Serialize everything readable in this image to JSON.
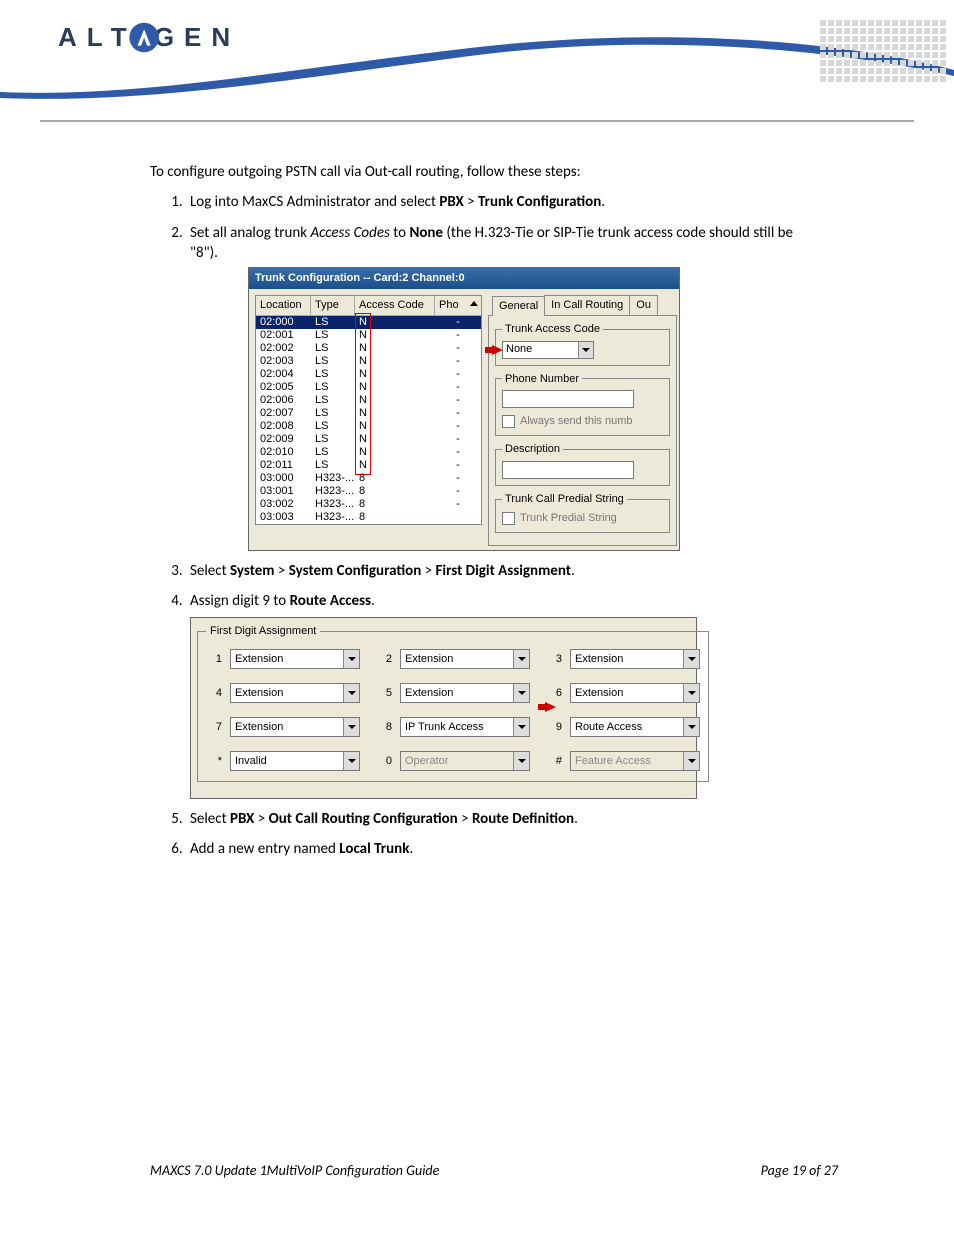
{
  "brand": "ALTIGEN",
  "intro": "To configure outgoing PSTN call via Out-call routing, follow these steps:",
  "steps": {
    "s1": {
      "pre": "Log into MaxCS Administrator and select ",
      "b1": "PBX",
      "mid": " > ",
      "b2": "Trunk Configuration",
      "post": "."
    },
    "s2": {
      "pre": "Set all analog trunk ",
      "i1": "Access Codes",
      "mid": " to ",
      "b1": "None",
      "post": " (the H.323-Tie or SIP-Tie trunk access code should still be \"8\")."
    },
    "s3": {
      "pre": "Select ",
      "b1": "System",
      "m1": " > ",
      "b2": "System Configuration",
      "m2": " > ",
      "b3": "First Digit Assignment",
      "post": "."
    },
    "s4": {
      "pre": "Assign digit 9 to ",
      "b1": "Route Access",
      "post": "."
    },
    "s5": {
      "pre": "Select ",
      "b1": "PBX",
      "m1": " > ",
      "b2": "Out Call Routing Configuration",
      "m2": " > ",
      "b3": "Route Definition",
      "post": "."
    },
    "s6": {
      "pre": "Add a new entry named ",
      "b1": "Local Trunk",
      "post": "."
    }
  },
  "shot1": {
    "title": "Trunk Configuration -- Card:2 Channel:0",
    "headers": {
      "loc": "Location",
      "type": "Type",
      "ac": "Access Code",
      "pho": "Pho"
    },
    "rows": [
      {
        "loc": "02:000",
        "type": "LS",
        "ac": "N",
        "pho": "-",
        "sel": true
      },
      {
        "loc": "02:001",
        "type": "LS",
        "ac": "N",
        "pho": "-"
      },
      {
        "loc": "02:002",
        "type": "LS",
        "ac": "N",
        "pho": "-"
      },
      {
        "loc": "02:003",
        "type": "LS",
        "ac": "N",
        "pho": "-"
      },
      {
        "loc": "02:004",
        "type": "LS",
        "ac": "N",
        "pho": "-"
      },
      {
        "loc": "02:005",
        "type": "LS",
        "ac": "N",
        "pho": "-"
      },
      {
        "loc": "02:006",
        "type": "LS",
        "ac": "N",
        "pho": "-"
      },
      {
        "loc": "02:007",
        "type": "LS",
        "ac": "N",
        "pho": "-"
      },
      {
        "loc": "02:008",
        "type": "LS",
        "ac": "N",
        "pho": "-"
      },
      {
        "loc": "02:009",
        "type": "LS",
        "ac": "N",
        "pho": "-"
      },
      {
        "loc": "02:010",
        "type": "LS",
        "ac": "N",
        "pho": "-"
      },
      {
        "loc": "02:011",
        "type": "LS",
        "ac": "N",
        "pho": "-"
      },
      {
        "loc": "03:000",
        "type": "H323-...",
        "ac": "8",
        "pho": "-"
      },
      {
        "loc": "03:001",
        "type": "H323-...",
        "ac": "8",
        "pho": "-"
      },
      {
        "loc": "03:002",
        "type": "H323-...",
        "ac": "8",
        "pho": "-"
      },
      {
        "loc": "03:003",
        "type": "H323-...",
        "ac": "8",
        "pho": ""
      }
    ],
    "tabs": {
      "general": "General",
      "incall": "In Call Routing",
      "out": "Ou"
    },
    "groups": {
      "tac": "Trunk Access Code",
      "tac_val": "None",
      "phone": "Phone Number",
      "always": "Always send this numb",
      "desc": "Description",
      "predial": "Trunk Call Predial String",
      "predial_chk": "Trunk Predial String"
    }
  },
  "shot2": {
    "legend": "First Digit Assignment",
    "cells": [
      {
        "k": "1",
        "v": "Extension"
      },
      {
        "k": "2",
        "v": "Extension"
      },
      {
        "k": "3",
        "v": "Extension"
      },
      {
        "k": "4",
        "v": "Extension"
      },
      {
        "k": "5",
        "v": "Extension"
      },
      {
        "k": "6",
        "v": "Extension"
      },
      {
        "k": "7",
        "v": "Extension"
      },
      {
        "k": "8",
        "v": "IP Trunk Access"
      },
      {
        "k": "9",
        "v": "Route Access"
      },
      {
        "k": "*",
        "v": "Invalid"
      },
      {
        "k": "0",
        "v": "Operator",
        "disabled": true
      },
      {
        "k": "#",
        "v": "Feature Access",
        "disabled": true
      }
    ]
  },
  "footer": {
    "left": "MAXCS 7.0 Update 1MultiVoIP Configuration Guide",
    "right": "Page 19 of 27"
  }
}
